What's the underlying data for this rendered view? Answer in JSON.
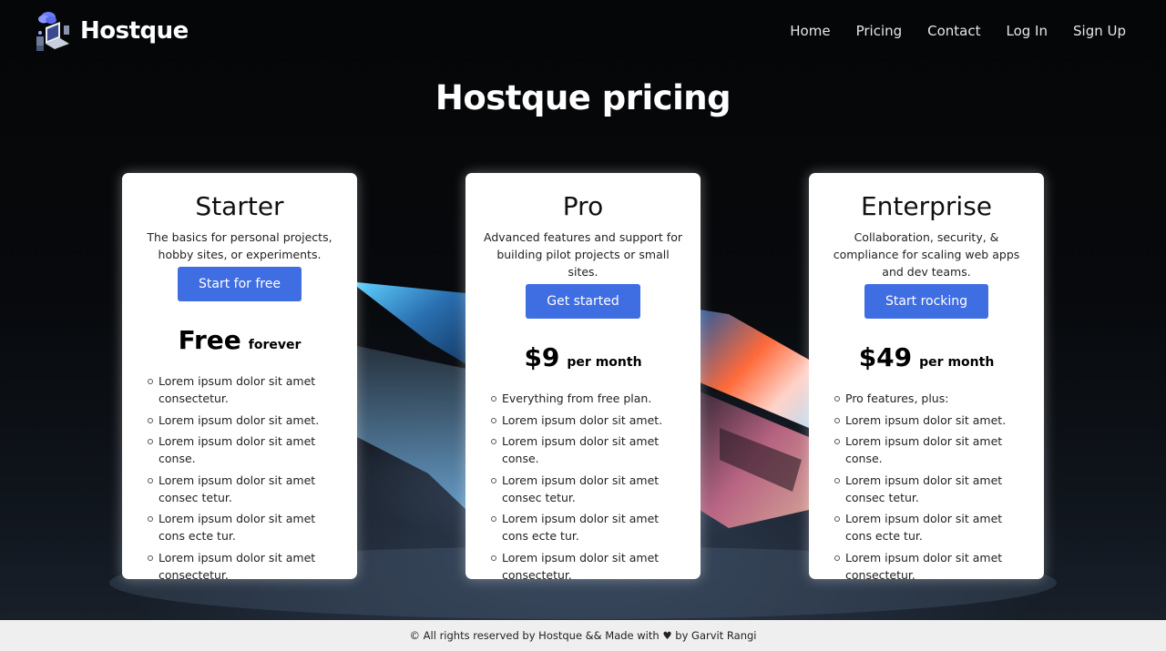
{
  "brand": {
    "name": "Hostque",
    "logo_icon": "server-cloud-logo-icon"
  },
  "nav": {
    "links": [
      {
        "label": "Home"
      },
      {
        "label": "Pricing"
      },
      {
        "label": "Contact"
      },
      {
        "label": "Log In"
      },
      {
        "label": "Sign Up"
      }
    ]
  },
  "hero": {
    "title": "Hostque pricing"
  },
  "plans": [
    {
      "name": "Starter",
      "description": "The basics for personal projects, hobby sites, or experiments.",
      "button": "Start for free",
      "price": "Free",
      "period": "forever",
      "features": [
        "Lorem ipsum dolor sit amet consectetur.",
        "Lorem ipsum dolor sit amet.",
        "Lorem ipsum dolor sit amet conse.",
        "Lorem ipsum dolor sit amet consec tetur.",
        "Lorem ipsum dolor sit amet cons ecte tur.",
        "Lorem ipsum dolor sit amet consectetur."
      ]
    },
    {
      "name": "Pro",
      "description": "Advanced features and support for building pilot projects or small sites.",
      "button": "Get started",
      "price": "$9",
      "period": "per month",
      "features": [
        "Everything from free plan.",
        "Lorem ipsum dolor sit amet.",
        "Lorem ipsum dolor sit amet conse.",
        "Lorem ipsum dolor sit amet consec tetur.",
        "Lorem ipsum dolor sit amet cons ecte tur.",
        "Lorem ipsum dolor sit amet consectetur."
      ]
    },
    {
      "name": "Enterprise",
      "description": "Collaboration, security, & compliance for scaling web apps and dev teams.",
      "button": "Start rocking",
      "price": "$49",
      "period": "per month",
      "features": [
        "Pro features, plus:",
        "Lorem ipsum dolor sit amet.",
        "Lorem ipsum dolor sit amet conse.",
        "Lorem ipsum dolor sit amet consec tetur.",
        "Lorem ipsum dolor sit amet cons ecte tur.",
        "Lorem ipsum dolor sit amet consectetur."
      ]
    }
  ],
  "footer": {
    "text": "© All rights reserved by Hostque && Made with ♥ by Garvit Rangi"
  },
  "colors": {
    "accent": "#3f6ee3",
    "footer_bg": "#efefef",
    "card_bg": "#ffffff"
  }
}
